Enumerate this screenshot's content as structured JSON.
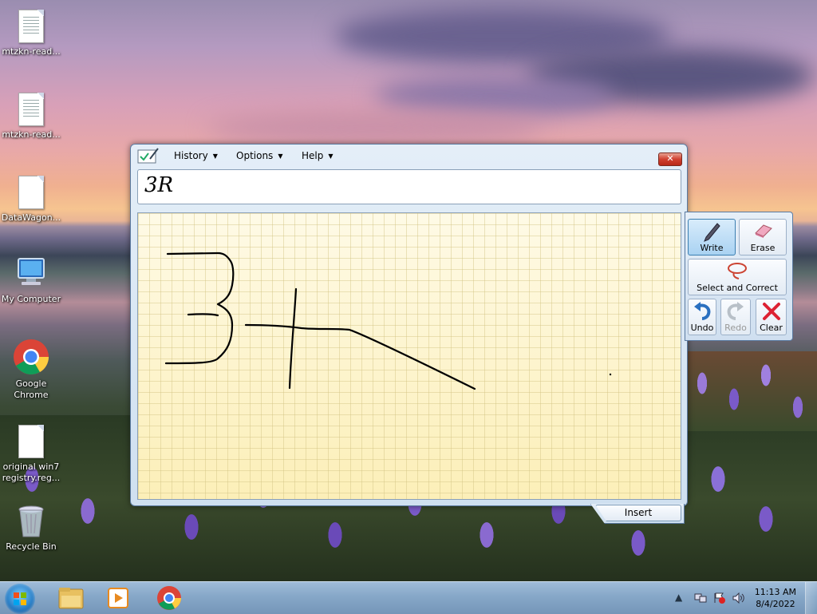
{
  "desktop": {
    "icons": [
      {
        "label": "mtzkn-read..."
      },
      {
        "label": "mtzkn-read..."
      },
      {
        "label": "DataWagon..."
      },
      {
        "label": "My Computer"
      },
      {
        "label": "Google Chrome"
      },
      {
        "label": "original win7 registry.reg..."
      },
      {
        "label": "Recycle Bin"
      }
    ]
  },
  "tip": {
    "menu": {
      "history": "History",
      "options": "Options",
      "help": "Help"
    },
    "close_label": "✕",
    "recognized_text": "3R",
    "insert_label": "Insert",
    "tools": {
      "write": "Write",
      "erase": "Erase",
      "select_correct": "Select and Correct",
      "undo": "Undo",
      "redo": "Redo",
      "clear": "Clear"
    }
  },
  "taskbar": {
    "clock_time": "11:13 AM",
    "clock_date": "8/4/2022",
    "pinned": [
      {
        "icon": "file-explorer-icon"
      },
      {
        "icon": "media-player-icon"
      },
      {
        "icon": "chrome-icon"
      }
    ]
  },
  "colors": {
    "canvas": "#fdf3c0",
    "window": "#cfe0f0",
    "taskbar": "#86a7c8"
  }
}
